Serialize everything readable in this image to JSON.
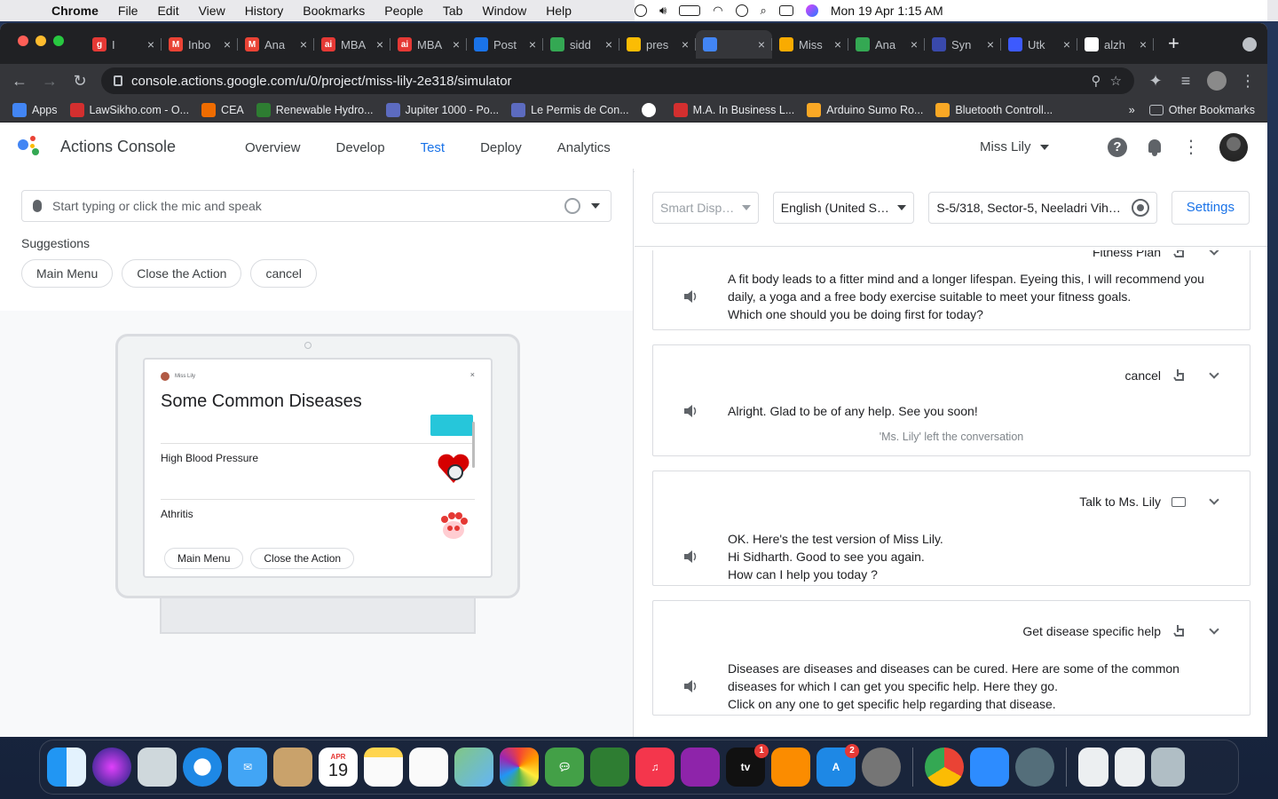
{
  "menubar": {
    "app": "Chrome",
    "items": [
      "File",
      "Edit",
      "View",
      "History",
      "Bookmarks",
      "People",
      "Tab",
      "Window",
      "Help"
    ],
    "clock": "Mon 19 Apr  1:15 AM"
  },
  "browser": {
    "tabs": [
      {
        "label": "I",
        "color": "#e53935",
        "glyph": "g"
      },
      {
        "label": "Inbo",
        "color": "#ea4335",
        "glyph": "M"
      },
      {
        "label": "Ana",
        "color": "#ea4335",
        "glyph": "M"
      },
      {
        "label": "MBA",
        "color": "#e53935",
        "glyph": "ai"
      },
      {
        "label": "MBA",
        "color": "#e53935",
        "glyph": "ai"
      },
      {
        "label": "Post",
        "color": "#1a73e8",
        "glyph": ""
      },
      {
        "label": "sidd",
        "color": "#34a853",
        "glyph": ""
      },
      {
        "label": "pres",
        "color": "#fbbc04",
        "glyph": ""
      },
      {
        "label": "",
        "color": "#4285f4",
        "glyph": ""
      },
      {
        "label": "Miss",
        "color": "#f9ab00",
        "glyph": ""
      },
      {
        "label": "Ana",
        "color": "#34a853",
        "glyph": ""
      },
      {
        "label": "Syn",
        "color": "#3949ab",
        "glyph": ""
      },
      {
        "label": "Utk",
        "color": "#3d5afe",
        "glyph": ""
      },
      {
        "label": "alzh",
        "color": "#ffffff",
        "glyph": "G"
      }
    ],
    "url": "console.actions.google.com/u/0/project/miss-lily-2e318/simulator",
    "bookmarks": [
      {
        "label": "Apps",
        "color": "#4285f4"
      },
      {
        "label": "LawSikho.com - O...",
        "color": "#d32f2f"
      },
      {
        "label": "CEA",
        "color": "#ef6c00"
      },
      {
        "label": "Renewable Hydro...",
        "color": "#2e7d32"
      },
      {
        "label": "Jupiter 1000 - Po...",
        "color": "#5c6bc0"
      },
      {
        "label": "Le Permis de Con...",
        "color": "#5c6bc0"
      },
      {
        "label": "",
        "color": "#ffffff"
      },
      {
        "label": "M.A. In Business L...",
        "color": "#d32f2f"
      },
      {
        "label": "Arduino Sumo Ro...",
        "color": "#f9a825"
      },
      {
        "label": "Bluetooth Controll...",
        "color": "#f9a825"
      }
    ],
    "overflow": "»",
    "other_bookmarks": "Other Bookmarks"
  },
  "header": {
    "app_name": "Actions Console",
    "nav": [
      "Overview",
      "Develop",
      "Test",
      "Deploy",
      "Analytics"
    ],
    "active_nav": "Test",
    "project": "Miss Lily",
    "help": "?"
  },
  "simulator": {
    "input_placeholder": "Start typing or click the mic and speak",
    "suggestions_label": "Suggestions",
    "suggestions": [
      "Main Menu",
      "Close the Action",
      "cancel"
    ],
    "device_screen": {
      "agent_name": "Miss Lily",
      "close": "×",
      "title": "Some Common Diseases",
      "items": [
        "High Blood Pressure",
        "Athritis"
      ],
      "chips": [
        "Main Menu",
        "Close the Action"
      ]
    }
  },
  "settings": {
    "surface": "Smart Displa...",
    "language": "English (United Sta...",
    "location": "S-5/318, Sector-5, Neeladri Vihar, ...",
    "settings_button": "Settings"
  },
  "conversation": [
    {
      "query": "Fitness Plan",
      "input_icon": "touch",
      "response": [
        "A fit body leads to a fitter mind and a longer lifespan. Eyeing this, I will recommend you",
        "daily, a yoga and a free body exercise suitable to meet your fitness goals.",
        "Which one should you be doing first for today?"
      ],
      "note": ""
    },
    {
      "query": "cancel",
      "input_icon": "touch",
      "response": [
        "Alright. Glad to be of any help. See you soon!"
      ],
      "note": "'Ms. Lily' left the conversation"
    },
    {
      "query": "Talk to Ms. Lily",
      "input_icon": "keyboard",
      "response": [
        "OK. Here's the test version of Miss Lily.",
        "Hi Sidharth. Good to see you again.",
        "How can I help you today ?"
      ],
      "note": ""
    },
    {
      "query": "Get disease specific help",
      "input_icon": "touch",
      "response": [
        "Diseases are diseases and diseases can be cured. Here are some of the common",
        "diseases for which I can get you specific help. Here they go.",
        "Click on any one to get specific help regarding that disease."
      ],
      "note": ""
    }
  ],
  "dock": {
    "calendar_month": "APR",
    "calendar_day": "19",
    "badges": {
      "tv": "1",
      "appstore": "2"
    }
  }
}
